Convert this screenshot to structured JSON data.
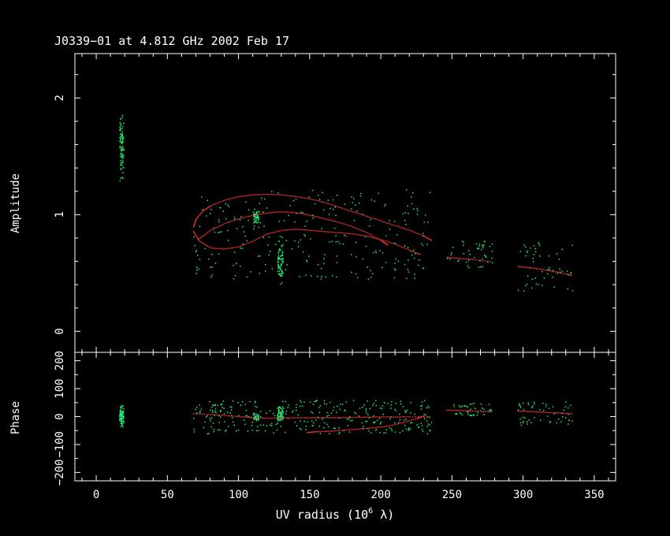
{
  "chart_data": {
    "type": "scatter",
    "title": "J0339−01 at 4.812 GHz 2002 Feb 17",
    "xlabel_main": "UV radius  (10",
    "xlabel_exp": "6",
    "xlabel_tail": " λ)",
    "xlim": [
      -15,
      365
    ],
    "x_ticks": [
      0,
      50,
      100,
      150,
      200,
      250,
      300,
      350
    ],
    "colors": {
      "axes": "#ffffff",
      "data": "#22ee77",
      "model": "#ee3333"
    },
    "panels": [
      {
        "name": "amplitude",
        "ylabel": "Amplitude",
        "ylim": [
          -0.18,
          2.38
        ],
        "y_ticks": [
          0,
          1,
          2
        ],
        "y_tick_labels": [
          "0",
          "1",
          "2"
        ],
        "clusters": [
          {
            "x": [
              16,
              19
            ],
            "y": [
              0.9,
              2.15
            ],
            "n": 90,
            "center": 1.65
          },
          {
            "x": [
              68,
              236
            ],
            "y": [
              0.45,
              1.22
            ],
            "n": 260
          },
          {
            "x": [
              110,
              114
            ],
            "y": [
              0.85,
              1.12
            ],
            "n": 50,
            "center": 0.98
          },
          {
            "x": [
              127,
              131
            ],
            "y": [
              0.15,
              0.9
            ],
            "n": 70,
            "center": 0.72
          },
          {
            "x": [
              246,
              278
            ],
            "y": [
              0.55,
              0.8
            ],
            "n": 45
          },
          {
            "x": [
              296,
              335
            ],
            "y": [
              0.35,
              0.8
            ],
            "n": 55
          }
        ],
        "model_curves": [
          {
            "x": [
              68,
              70,
              75,
              80,
              90,
              100,
              110,
              120,
              130,
              140,
              150,
              160,
              170,
              180,
              190,
              200,
              210,
              220,
              230,
              236
            ],
            "y": [
              0.9,
              0.97,
              1.04,
              1.08,
              1.13,
              1.16,
              1.175,
              1.18,
              1.175,
              1.16,
              1.14,
              1.11,
              1.07,
              1.03,
              0.99,
              0.95,
              0.91,
              0.87,
              0.82,
              0.78
            ]
          },
          {
            "x": [
              68,
              72,
              80,
              90,
              100,
              110,
              120,
              130,
              140,
              150,
              160,
              170,
              180,
              190,
              200,
              210,
              220,
              228
            ],
            "y": [
              0.86,
              0.78,
              0.72,
              0.71,
              0.73,
              0.78,
              0.84,
              0.87,
              0.88,
              0.87,
              0.86,
              0.85,
              0.84,
              0.82,
              0.79,
              0.75,
              0.7,
              0.66
            ]
          },
          {
            "x": [
              72,
              80,
              90,
              100,
              110,
              120,
              130,
              140,
              150,
              160,
              170,
              180,
              190,
              200,
              205
            ],
            "y": [
              0.8,
              0.87,
              0.93,
              0.97,
              1.0,
              1.02,
              1.03,
              1.02,
              1.0,
              0.97,
              0.94,
              0.9,
              0.85,
              0.78,
              0.74
            ]
          },
          {
            "x": [
              246,
              255,
              265,
              278
            ],
            "y": [
              0.64,
              0.63,
              0.62,
              0.6
            ]
          },
          {
            "x": [
              296,
              305,
              315,
              325,
              335
            ],
            "y": [
              0.56,
              0.55,
              0.53,
              0.51,
              0.48
            ]
          }
        ]
      },
      {
        "name": "phase",
        "ylabel": "Phase",
        "ylim": [
          -230,
          230
        ],
        "y_ticks": [
          -200,
          -100,
          0,
          100,
          200
        ],
        "y_tick_labels": [
          "−200",
          "−100",
          "0",
          "100",
          "200"
        ],
        "clusters": [
          {
            "x": [
              16,
              19
            ],
            "y": [
              -80,
              85
            ],
            "n": 80,
            "center": 0
          },
          {
            "x": [
              68,
              236
            ],
            "y": [
              -60,
              60
            ],
            "n": 320
          },
          {
            "x": [
              110,
              114
            ],
            "y": [
              -35,
              30
            ],
            "n": 40,
            "center": 0
          },
          {
            "x": [
              127,
              131
            ],
            "y": [
              -60,
              85
            ],
            "n": 60,
            "center": 0
          },
          {
            "x": [
              246,
              278
            ],
            "y": [
              5,
              50
            ],
            "n": 45
          },
          {
            "x": [
              296,
              335
            ],
            "y": [
              -30,
              55
            ],
            "n": 55
          }
        ],
        "model_curves": [
          {
            "x": [
              68,
              80,
              90,
              100,
              110,
              120,
              130,
              140,
              150,
              160,
              170,
              180,
              190,
              200,
              210,
              220,
              236
            ],
            "y": [
              12,
              10,
              6,
              2,
              -2,
              -4,
              -3,
              -2,
              -2,
              -2,
              -2,
              -1,
              0,
              1,
              0,
              2,
              0
            ]
          },
          {
            "x": [
              148,
              155,
              165,
              175,
              185,
              195,
              205,
              215,
              225,
              230
            ],
            "y": [
              -55,
              -52,
              -50,
              -46,
              -42,
              -38,
              -32,
              -20,
              -5,
              5
            ]
          },
          {
            "x": [
              246,
              255,
              265,
              278
            ],
            "y": [
              25,
              24,
              22,
              20
            ]
          },
          {
            "x": [
              296,
              305,
              315,
              325,
              335
            ],
            "y": [
              22,
              20,
              17,
              15,
              12
            ]
          }
        ]
      }
    ]
  }
}
